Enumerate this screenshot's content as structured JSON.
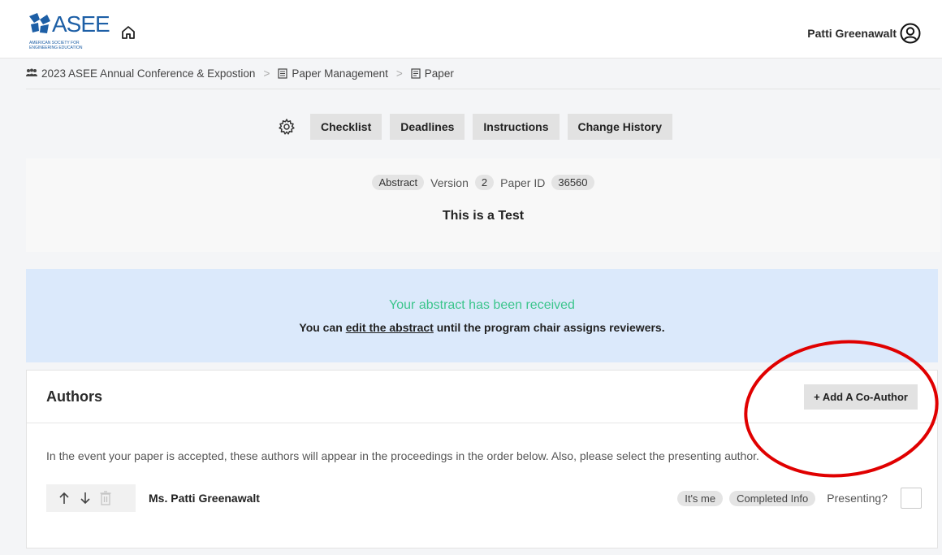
{
  "header": {
    "logo_text": "ASEE",
    "logo_subtitle": "AMERICAN SOCIETY FOR\nENGINEERING EDUCATION",
    "user_name": "Patti Greenawalt",
    "icons": {
      "home": "home-icon",
      "user": "user-circle-icon"
    }
  },
  "breadcrumb": {
    "items": [
      {
        "label": "2023 ASEE Annual Conference & Expostion",
        "icon": "people-icon"
      },
      {
        "label": "Paper Management",
        "icon": "list-icon"
      },
      {
        "label": "Paper",
        "icon": "document-icon"
      }
    ],
    "separator": ">"
  },
  "toolbar": {
    "buttons": [
      "Checklist",
      "Deadlines",
      "Instructions",
      "Change History"
    ],
    "icon": "gear-icon"
  },
  "paper": {
    "type": "Abstract",
    "version_label": "Version",
    "version": "2",
    "paper_id_label": "Paper ID",
    "paper_id": "36560",
    "title": "This is a Test"
  },
  "notice": {
    "title": "Your abstract has been received",
    "text_before": "You can ",
    "link": "edit the abstract",
    "text_after": " until the program chair assigns reviewers.",
    "title_color": "#3cc58c",
    "bg_color": "#dbe9fb"
  },
  "authors": {
    "title": "Authors",
    "add_button": "+ Add A Co-Author",
    "description": "In the event your paper is accepted, these authors will appear in the proceedings in the order below. Also, please select the presenting author.",
    "rows": [
      {
        "name": "Ms. Patti Greenawalt",
        "badges": [
          "It's me",
          "Completed Info"
        ],
        "presenting_label": "Presenting?",
        "presenting": false
      }
    ]
  },
  "annotation": {
    "color": "#e00000",
    "shape": "ellipse"
  }
}
